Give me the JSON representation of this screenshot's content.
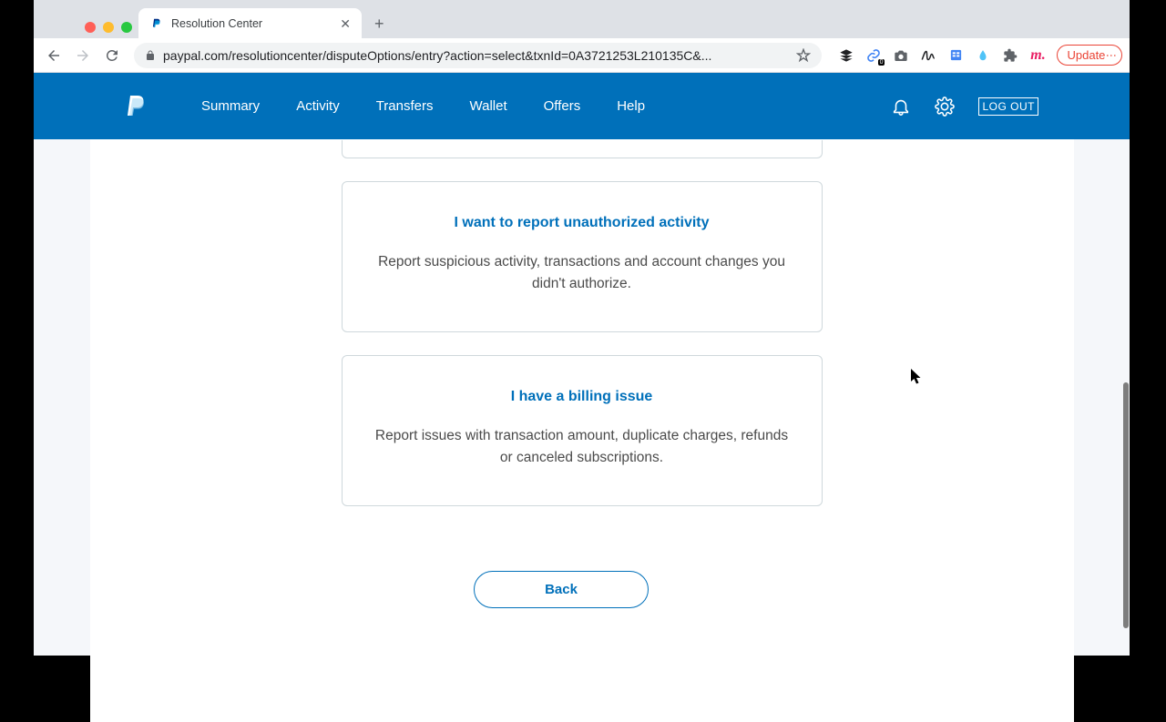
{
  "browser": {
    "tab_title": "Resolution Center",
    "url": "paypal.com/resolutioncenter/disputeOptions/entry?action=select&txnId=0A3721253L210135C&...",
    "update_label": "Update"
  },
  "header": {
    "nav": {
      "summary": "Summary",
      "activity": "Activity",
      "transfers": "Transfers",
      "wallet": "Wallet",
      "offers": "Offers",
      "help": "Help"
    },
    "logout": "LOG OUT"
  },
  "options": {
    "unauthorized": {
      "title": "I want to report unauthorized activity",
      "desc": "Report suspicious activity, transactions and account changes you didn't authorize."
    },
    "billing": {
      "title": "I have a billing issue",
      "desc": "Report issues with transaction amount, duplicate charges, refunds or canceled subscriptions."
    }
  },
  "back_label": "Back"
}
